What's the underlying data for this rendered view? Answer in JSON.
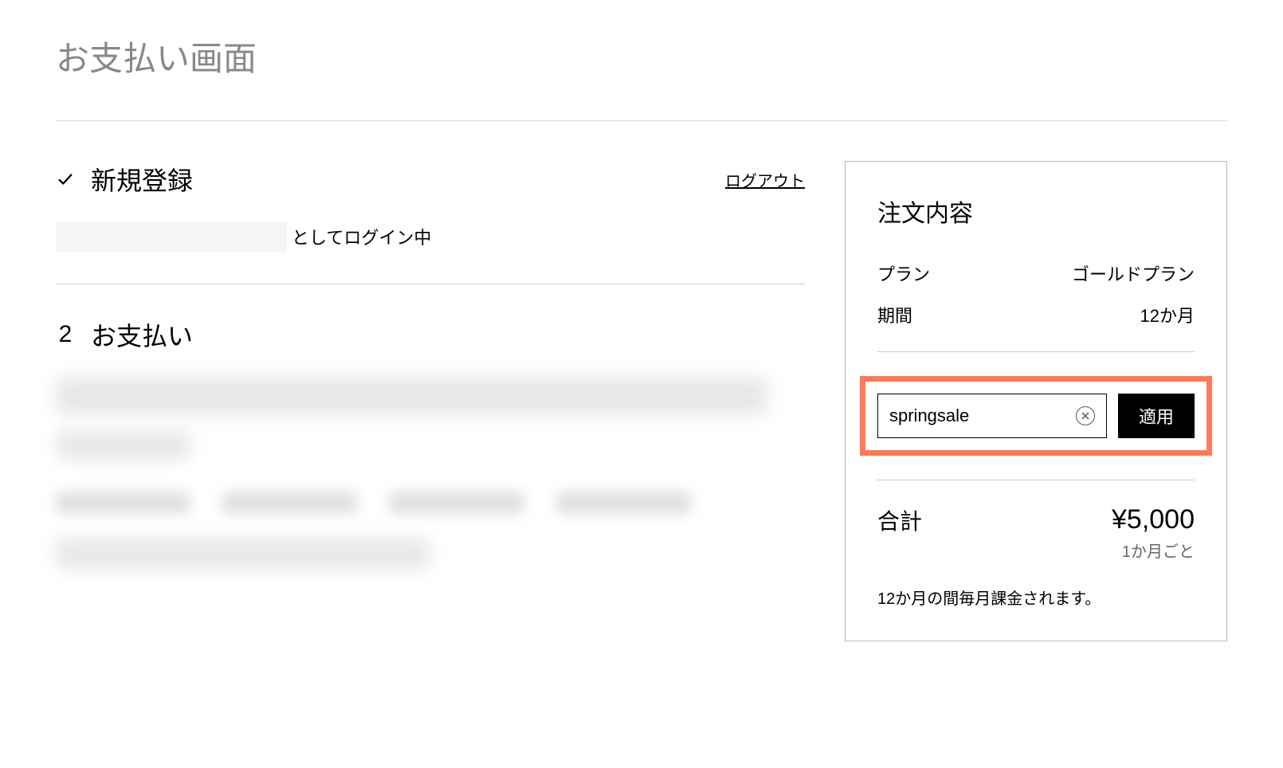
{
  "page": {
    "title": "お支払い画面"
  },
  "step1": {
    "title": "新規登録",
    "logout": "ログアウト",
    "login_status_suffix": "としてログイン中"
  },
  "step2": {
    "number": "2",
    "title": "お支払い"
  },
  "summary": {
    "title": "注文内容",
    "plan_label": "プラン",
    "plan_value": "ゴールドプラン",
    "period_label": "期間",
    "period_value": "12か月",
    "coupon_value": "springsale",
    "apply_label": "適用",
    "total_label": "合計",
    "total_amount": "¥5,000",
    "total_frequency": "1か月ごと",
    "billing_note": "12か月の間毎月課金されます。"
  }
}
